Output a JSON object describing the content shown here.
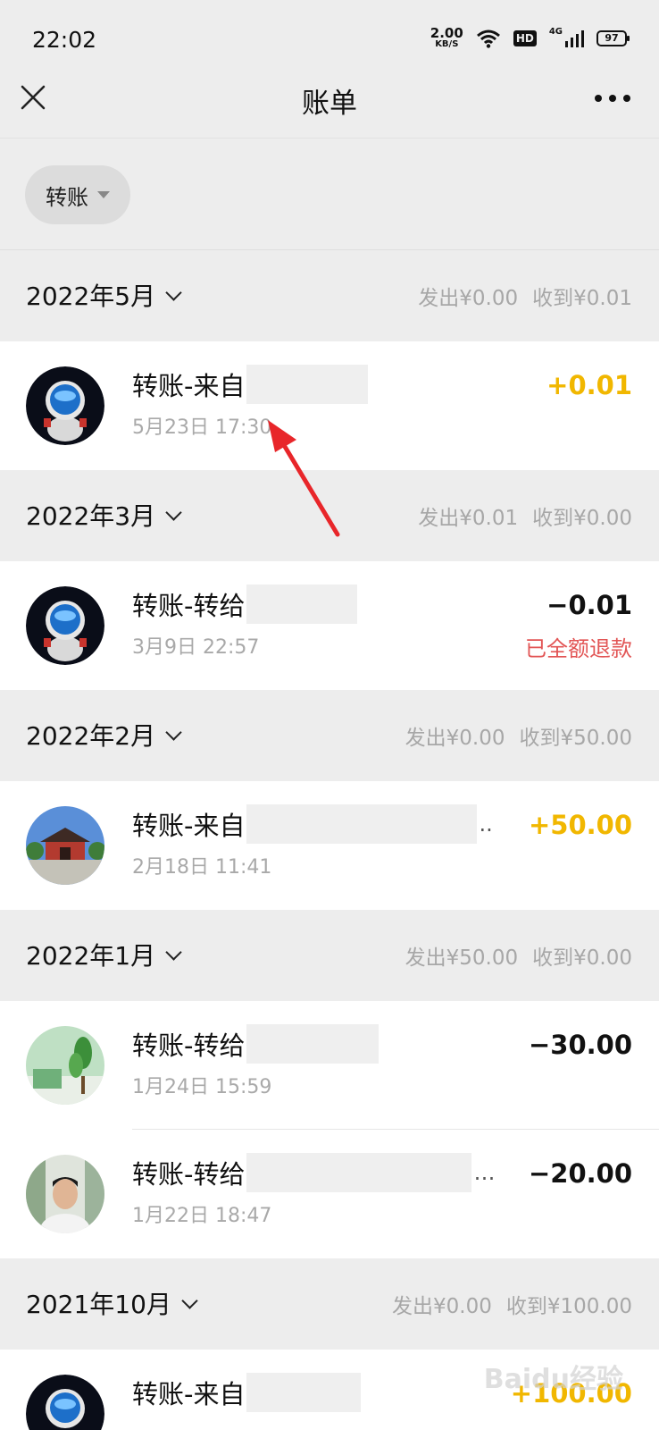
{
  "status_bar": {
    "time": "22:02",
    "net_speed_value": "2.00",
    "net_speed_unit": "KB/S",
    "hd_label": "HD",
    "signal_label": "4G",
    "battery": "97"
  },
  "nav": {
    "title": "账单"
  },
  "filter": {
    "label": "转账"
  },
  "months": [
    {
      "title": "2022年5月",
      "sent": "发出¥0.00",
      "received": "收到¥0.01"
    },
    {
      "title": "2022年3月",
      "sent": "发出¥0.01",
      "received": "收到¥0.00"
    },
    {
      "title": "2022年2月",
      "sent": "发出¥0.00",
      "received": "收到¥50.00"
    },
    {
      "title": "2022年1月",
      "sent": "发出¥50.00",
      "received": "收到¥0.00"
    },
    {
      "title": "2021年10月",
      "sent": "发出¥0.00",
      "received": "收到¥100.00"
    }
  ],
  "transactions": [
    {
      "title": "转账-来自",
      "time": "5月23日 17:30",
      "amount": "+0.01",
      "direction": "in",
      "note": "",
      "avatar": "astronaut"
    },
    {
      "title": "转账-转给",
      "time": "3月9日 22:57",
      "amount": "−0.01",
      "direction": "out",
      "note": "已全额退款",
      "avatar": "astronaut"
    },
    {
      "title": "转账-来自",
      "time": "2月18日 11:41",
      "amount": "+50.00",
      "direction": "in",
      "note": "",
      "avatar": "temple-photo"
    },
    {
      "title": "转账-转给",
      "time": "1月24日 15:59",
      "amount": "−30.00",
      "direction": "out",
      "note": "",
      "avatar": "plant-photo"
    },
    {
      "title": "转账-转给",
      "time": "1月22日 18:47",
      "amount": "−20.00",
      "direction": "out",
      "note": "",
      "avatar": "person-photo"
    },
    {
      "title": "转账-来自",
      "time": "",
      "amount": "+100.00",
      "direction": "in",
      "note": "",
      "avatar": "astronaut"
    }
  ],
  "watermark": "Baidu经验",
  "colors": {
    "income": "#f1b700",
    "expense": "#111111",
    "refund": "#e25555",
    "annotation_arrow": "#e8262a"
  }
}
